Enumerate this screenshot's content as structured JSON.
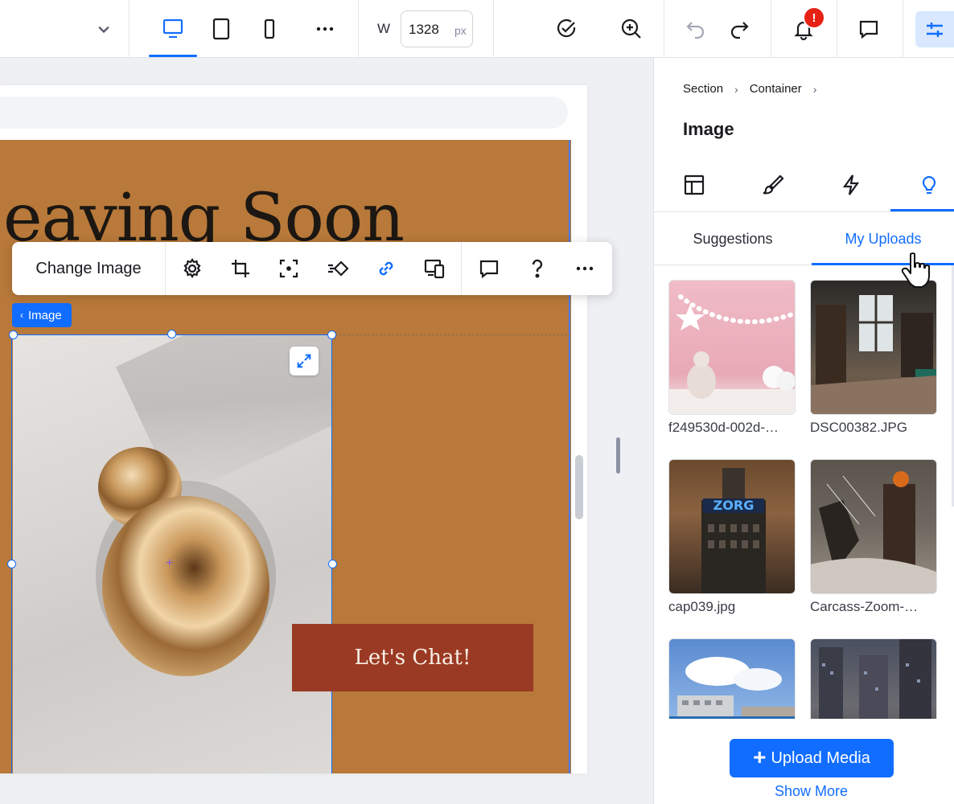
{
  "topbar": {
    "width_label": "W",
    "width_value": "1328",
    "width_unit": "px",
    "notification_badge": "!"
  },
  "canvas": {
    "headline": "eaving Soon",
    "image_tag": "Image",
    "cta_label": "Let's Chat!"
  },
  "toolbar": {
    "change_image": "Change Image"
  },
  "panel": {
    "breadcrumb": [
      "Section",
      "Container"
    ],
    "title": "Image",
    "tabs": [
      "Suggestions",
      "My Uploads"
    ],
    "active_tab": "My Uploads",
    "uploads": [
      {
        "label": "f249530d-002d-…"
      },
      {
        "label": "DSC00382.JPG"
      },
      {
        "label": "cap039.jpg"
      },
      {
        "label": "Carcass-Zoom-…"
      },
      {
        "label": ""
      },
      {
        "label": ""
      }
    ],
    "upload_button": "Upload Media",
    "show_more": "Show More"
  },
  "colors": {
    "accent": "#116dff",
    "site_background": "#b8793a",
    "cta_background": "#9b3a24",
    "badge": "#e62214"
  }
}
